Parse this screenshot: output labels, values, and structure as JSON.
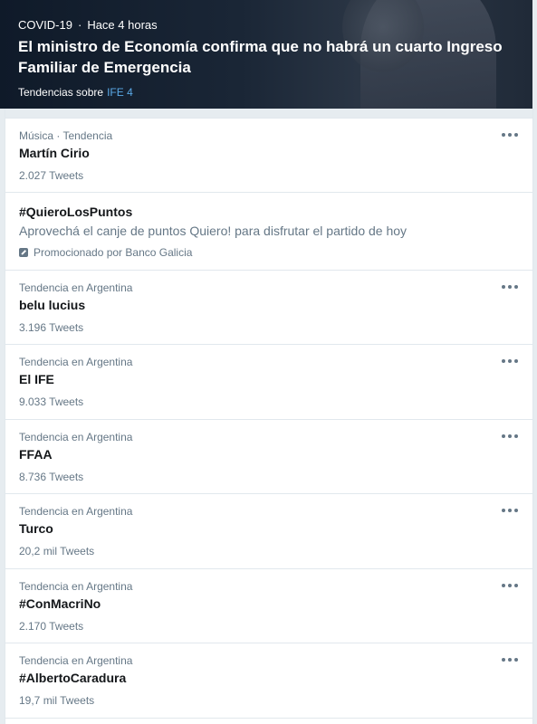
{
  "hero": {
    "category": "COVID-19",
    "separator": "·",
    "time": "Hace 4 horas",
    "title": "El ministro de Economía confirma que no habrá un cuarto Ingreso Familiar de Emergencia",
    "topics_label": "Tendencias sobre",
    "topics_link": "IFE 4"
  },
  "trends": [
    {
      "context": "Música · Tendencia",
      "name": "Martín Cirio",
      "count": "2.027 Tweets"
    },
    {
      "context": "Tendencia en Argentina",
      "name": "belu lucius",
      "count": "3.196 Tweets"
    },
    {
      "context": "Tendencia en Argentina",
      "name": "El IFE",
      "count": "9.033 Tweets"
    },
    {
      "context": "Tendencia en Argentina",
      "name": "FFAA",
      "count": "8.736 Tweets"
    },
    {
      "context": "Tendencia en Argentina",
      "name": "Turco",
      "count": "20,2 mil Tweets"
    },
    {
      "context": "Tendencia en Argentina",
      "name": "#ConMacriNo",
      "count": "2.170 Tweets"
    },
    {
      "context": "Tendencia en Argentina",
      "name": "#AlbertoCaradura",
      "count": "19,7 mil Tweets"
    }
  ],
  "promoted": {
    "name": "#QuieroLosPuntos",
    "description": "Aprovechá el canje de puntos Quiero! para disfrutar el partido de hoy",
    "promoted_by": "Promocionado por Banco Galicia",
    "icon": "promoted-icon"
  },
  "icons": {
    "more": "more-options-icon"
  },
  "colors": {
    "link": "#5aa9e6",
    "secondary_text": "#657786",
    "primary_text": "#14171a",
    "background": "#e6ecf0"
  }
}
